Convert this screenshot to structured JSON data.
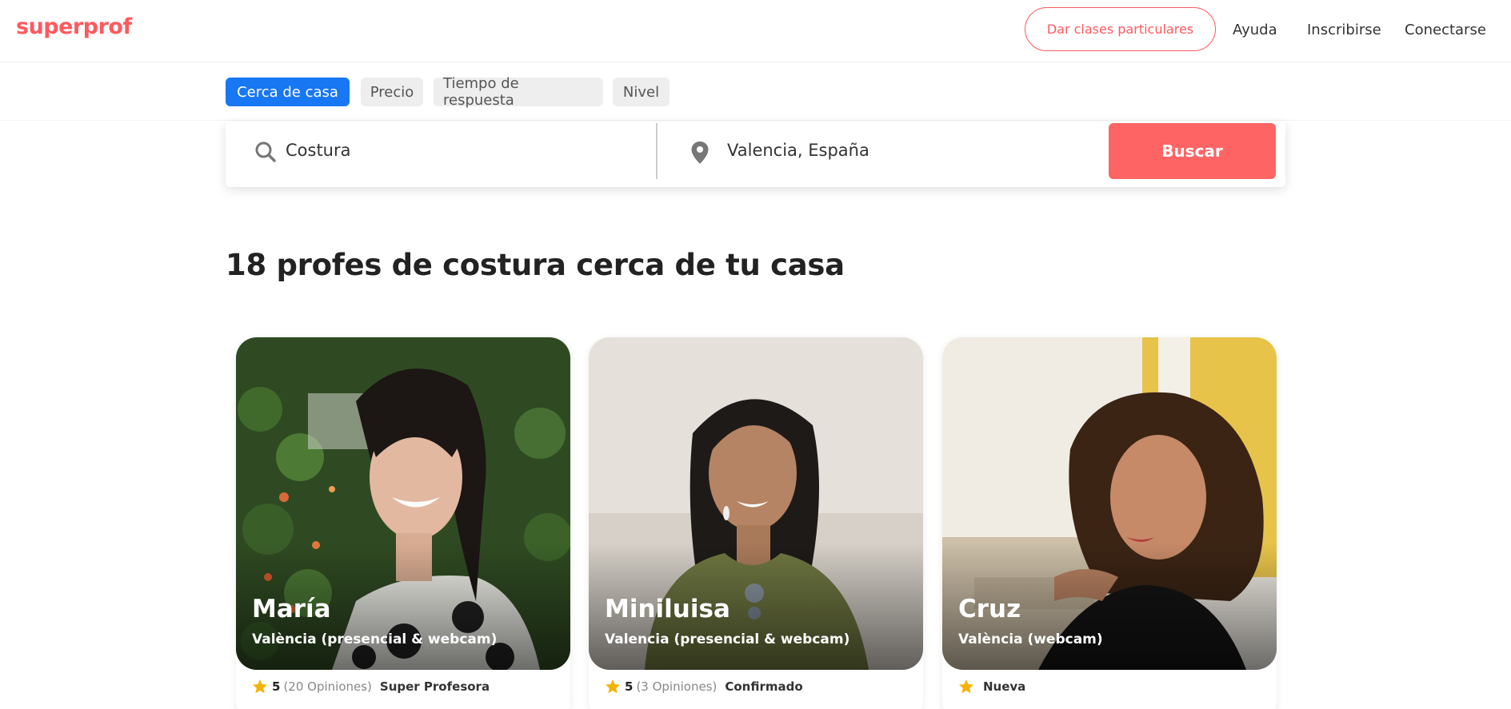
{
  "header": {
    "logo": "superprof",
    "teach_button": "Dar clases particulares",
    "links": [
      "Ayuda",
      "Inscribirse",
      "Conectarse"
    ]
  },
  "filters": [
    {
      "label": "Cerca de casa",
      "active": true
    },
    {
      "label": "Precio",
      "active": false
    },
    {
      "label": "Tiempo de respuesta",
      "active": false
    },
    {
      "label": "Nivel",
      "active": false
    }
  ],
  "search": {
    "subject": "Costura",
    "location": "Valencia, España",
    "button": "Buscar"
  },
  "results_heading": "18 profes de costura cerca de tu casa",
  "teachers": [
    {
      "name": "María",
      "location": "València (presencial & webcam)",
      "score": "5",
      "reviews": "(20 Opiniones)",
      "badge": "Super Profesora"
    },
    {
      "name": "Miniluisa",
      "location": "Valencia (presencial & webcam)",
      "score": "5",
      "reviews": "(3 Opiniones)",
      "badge": "Confirmado"
    },
    {
      "name": "Cruz",
      "location": "València (webcam)",
      "score": "",
      "reviews": "",
      "badge": "Nueva"
    }
  ],
  "colors": {
    "brand": "#ff5a5f",
    "active_chip": "#1877f2",
    "search_button": "#ff6464",
    "star": "#f5b301"
  }
}
